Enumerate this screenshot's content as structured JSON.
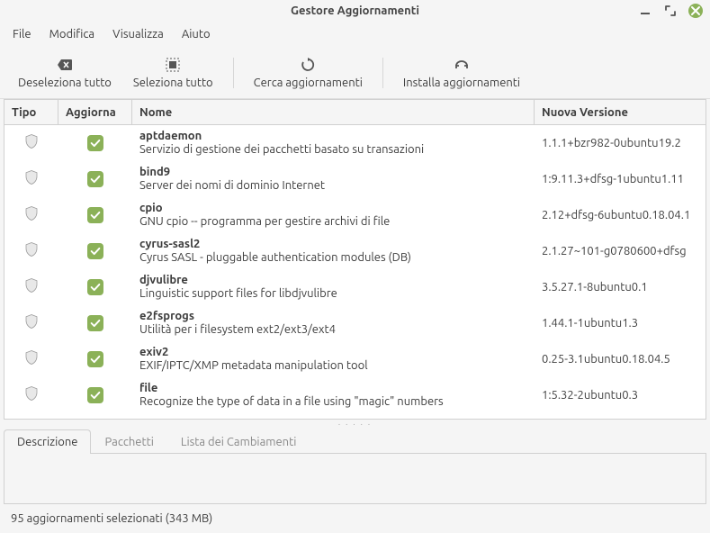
{
  "window": {
    "title": "Gestore Aggiornamenti"
  },
  "menu": {
    "file": "File",
    "modifica": "Modifica",
    "visualizza": "Visualizza",
    "aiuto": "Aiuto"
  },
  "toolbar": {
    "deselect": "Deseleziona tutto",
    "select": "Seleziona tutto",
    "refresh": "Cerca aggiornamenti",
    "install": "Installa aggiornamenti"
  },
  "columns": {
    "tipo": "Tipo",
    "aggiorna": "Aggiorna",
    "nome": "Nome",
    "versione": "Nuova Versione"
  },
  "updates": [
    {
      "name": "aptdaemon",
      "desc": "Servizio di gestione dei pacchetti basato su transazioni",
      "version": "1.1.1+bzr982-0ubuntu19.2"
    },
    {
      "name": "bind9",
      "desc": "Server dei nomi di dominio Internet",
      "version": "1:9.11.3+dfsg-1ubuntu1.11"
    },
    {
      "name": "cpio",
      "desc": "GNU cpio -- programma per gestire archivi di file",
      "version": "2.12+dfsg-6ubuntu0.18.04.1"
    },
    {
      "name": "cyrus-sasl2",
      "desc": "Cyrus SASL - pluggable authentication modules (DB)",
      "version": "2.1.27~101-g0780600+dfsg"
    },
    {
      "name": "djvulibre",
      "desc": "Linguistic support files for libdjvulibre",
      "version": "3.5.27.1-8ubuntu0.1"
    },
    {
      "name": "e2fsprogs",
      "desc": "Utilità per i filesystem ext2/ext3/ext4",
      "version": "1.44.1-1ubuntu1.3"
    },
    {
      "name": "exiv2",
      "desc": "EXIF/IPTC/XMP metadata manipulation tool",
      "version": "0.25-3.1ubuntu0.18.04.5"
    },
    {
      "name": "file",
      "desc": "Recognize the type of data in a file using \"magic\" numbers",
      "version": "1:5.32-2ubuntu0.3"
    }
  ],
  "tabs": {
    "descrizione": "Descrizione",
    "pacchetti": "Pacchetti",
    "cambiamenti": "Lista dei Cambiamenti"
  },
  "statusbar": "95 aggiornamenti selezionati (343 MB)"
}
